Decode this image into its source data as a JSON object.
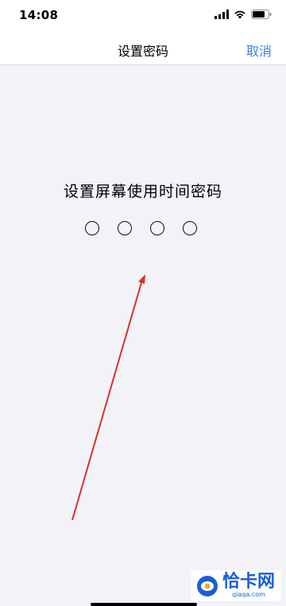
{
  "status_bar": {
    "time": "14:08",
    "icons": [
      "signal-icon",
      "wifi-icon",
      "battery-icon"
    ]
  },
  "nav": {
    "title": "设置密码",
    "cancel_label": "取消"
  },
  "main": {
    "prompt": "设置屏幕使用时间密码",
    "passcode_length": 4,
    "digits_entered": 0
  },
  "watermark": {
    "main_text": "恰卡网",
    "sub_text": "qiaqa.com"
  },
  "colors": {
    "accent": "#3a7ff0",
    "background": "#f2f2f7",
    "annotation": "#d9302c",
    "watermark": "#1b5fd6"
  }
}
